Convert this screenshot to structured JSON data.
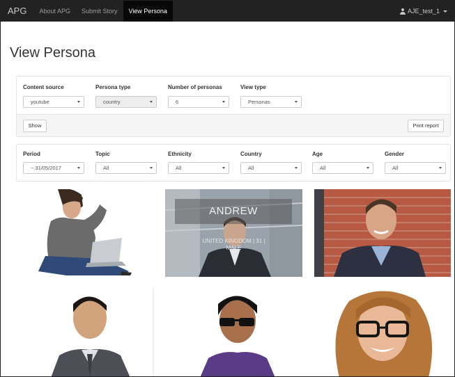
{
  "navbar": {
    "brand": "APG",
    "links": [
      "About APG",
      "Submit Story",
      "View Persona"
    ],
    "active_link": "View Persona",
    "user": "AJE_test_1"
  },
  "page_title": "View Persona",
  "filters_top": {
    "content_source": {
      "label": "Content source",
      "value": "youtube"
    },
    "persona_type": {
      "label": "Persona type",
      "value": "country",
      "disabled": true
    },
    "number_of_personas": {
      "label": "Number of personas",
      "value": "6"
    },
    "view_type": {
      "label": "View type",
      "value": "Personas"
    },
    "show_button": "Show",
    "print_button": "Print report"
  },
  "filters_bottom": {
    "period": {
      "label": "Period",
      "value": "~ 31/05/2017"
    },
    "topic": {
      "label": "Topic",
      "value": "All"
    },
    "ethnicity": {
      "label": "Ethnicity",
      "value": "All"
    },
    "country": {
      "label": "Country",
      "value": "All"
    },
    "age": {
      "label": "Age",
      "value": "All"
    },
    "gender": {
      "label": "Gender",
      "value": "All"
    }
  },
  "personas": [
    {
      "photo": "young man with laptop"
    },
    {
      "photo": "man in suit",
      "overlay_name": "ANDREW",
      "overlay_line1": "UNITED KINGDOM | 31 |",
      "overlay_line2": "MALE"
    },
    {
      "photo": "smiling man by brick wall"
    },
    {
      "photo": "young man in shirt and tie"
    },
    {
      "photo": "man with sunglasses"
    },
    {
      "photo": "smiling woman with glasses"
    }
  ],
  "colors": {
    "navbar": "#222222",
    "active_nav": "#080808",
    "panel_footer": "#f5f5f5"
  }
}
